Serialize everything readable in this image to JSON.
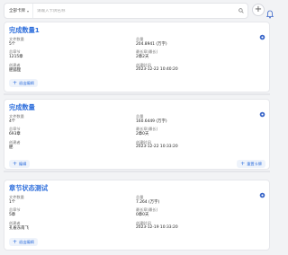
{
  "search": {
    "scope_label": "全部卡牌",
    "placeholder": "请输入卡牌名称"
  },
  "cards": [
    {
      "title": "完成数量1",
      "fields": [
        {
          "label": "文件数量",
          "value": "5个"
        },
        {
          "label": "总量",
          "value": "204.8941 (万字)"
        },
        {
          "label": "总章节",
          "value": "1215章"
        },
        {
          "label": "最长章(最长)",
          "value": "2章2天"
        },
        {
          "label": "创建者",
          "value": "肥狐狸"
        },
        {
          "label": "创建时间",
          "value": "2023-12-22 10:40:20"
        }
      ],
      "left_button": "退出编辑",
      "right_button": ""
    },
    {
      "title": "完成数量",
      "fields": [
        {
          "label": "文件数量",
          "value": "4个"
        },
        {
          "label": "总量",
          "value": "160.6449 (万字)"
        },
        {
          "label": "总章节",
          "value": "693章"
        },
        {
          "label": "最长章(最长)",
          "value": "2章0天"
        },
        {
          "label": "创建者",
          "value": "肥"
        },
        {
          "label": "创建时间",
          "value": "2023-12-22 10:33:20"
        }
      ],
      "left_button": "编辑",
      "right_button": "重置卡牌"
    },
    {
      "title": "章节状态测试",
      "fields": [
        {
          "label": "文件数量",
          "value": "1个"
        },
        {
          "label": "总量",
          "value": "7.264 (万字)"
        },
        {
          "label": "总章节",
          "value": "5章"
        },
        {
          "label": "最长章(最长)",
          "value": "0章0天"
        },
        {
          "label": "创建者",
          "value": "孔雀东南飞"
        },
        {
          "label": "创建时间",
          "value": "2023-12-19 10:33:20"
        }
      ],
      "left_button": "退出编辑",
      "right_button": ""
    }
  ],
  "colors": {
    "accent": "#2f6fdc",
    "background": "#f2f3f5"
  },
  "icons": [
    "search-icon",
    "add-icon",
    "bell-icon",
    "gear-icon",
    "plus-icon",
    "chevron-down-icon"
  ]
}
